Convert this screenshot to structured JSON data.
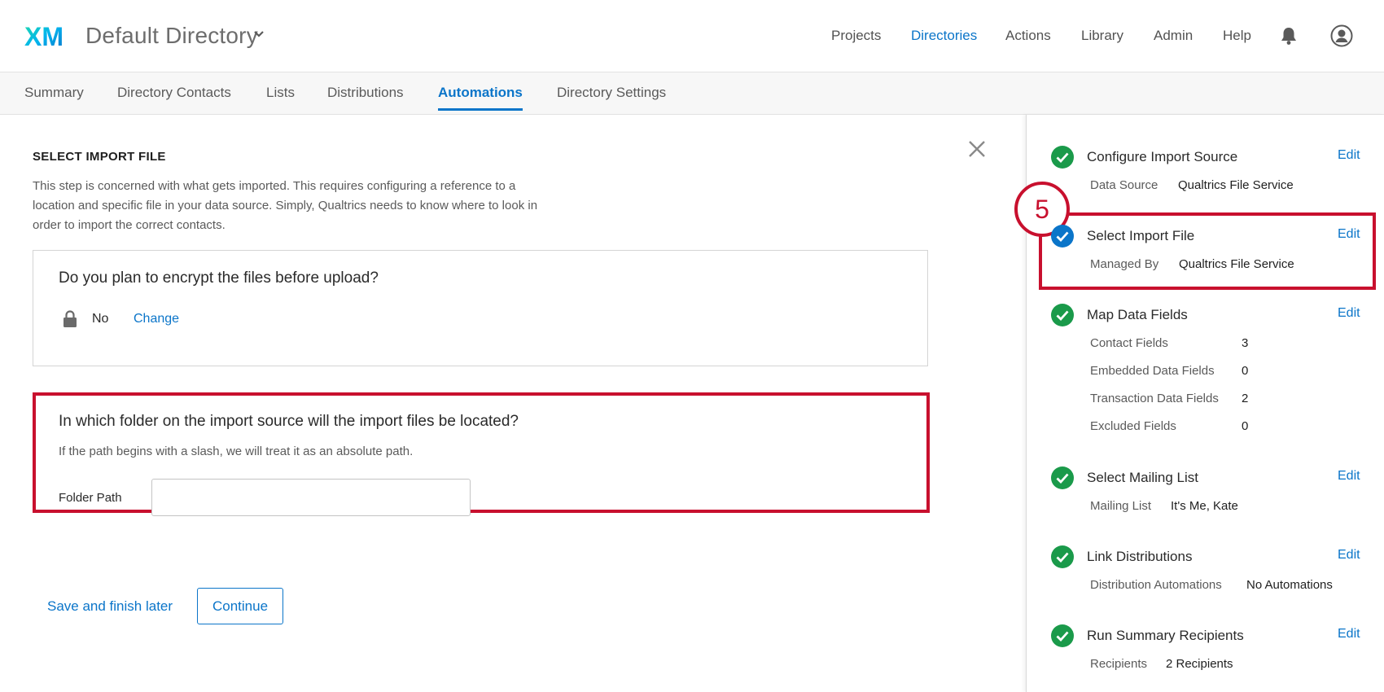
{
  "header": {
    "logo_text": "XM",
    "directory_title": "Default Directory",
    "nav": [
      {
        "label": "Projects",
        "active": false
      },
      {
        "label": "Directories",
        "active": true
      },
      {
        "label": "Actions",
        "active": false
      },
      {
        "label": "Library",
        "active": false
      },
      {
        "label": "Admin",
        "active": false
      },
      {
        "label": "Help",
        "active": false
      }
    ],
    "icons": [
      "bell-icon",
      "user-icon"
    ]
  },
  "tabs": [
    {
      "label": "Summary",
      "active": false
    },
    {
      "label": "Directory Contacts",
      "active": false
    },
    {
      "label": "Lists",
      "active": false
    },
    {
      "label": "Distributions",
      "active": false
    },
    {
      "label": "Automations",
      "active": true
    },
    {
      "label": "Directory Settings",
      "active": false
    }
  ],
  "main": {
    "section_title": "SELECT IMPORT FILE",
    "section_desc": "This step is concerned with what gets imported. This requires configuring a reference to a location and specific file in your data source. Simply, Qualtrics needs to know where to look in order to import the correct contacts.",
    "encrypt_card": {
      "question": "Do you plan to encrypt the files before upload?",
      "answer": "No",
      "change_label": "Change"
    },
    "folder_card": {
      "question": "In which folder on the import source will the import files be located?",
      "hint": "If the path begins with a slash, we will treat it as an absolute path.",
      "field_label": "Folder Path",
      "field_value": "",
      "field_placeholder": ""
    },
    "save_later_label": "Save and finish later",
    "continue_label": "Continue"
  },
  "sidebar": {
    "annotation_number": "5",
    "steps": [
      {
        "name": "Configure Import Source",
        "edit": "Edit",
        "status": "complete",
        "details": [
          {
            "k": "Data Source",
            "v": "Qualtrics File Service"
          }
        ]
      },
      {
        "name": "Select Import File",
        "edit": "Edit",
        "status": "current",
        "details": [
          {
            "k": "Managed By",
            "v": "Qualtrics File Service"
          }
        ]
      },
      {
        "name": "Map Data Fields",
        "edit": "Edit",
        "status": "complete",
        "details": [
          {
            "k": "Contact Fields",
            "v": "3"
          },
          {
            "k": "Embedded Data Fields",
            "v": "0"
          },
          {
            "k": "Transaction Data Fields",
            "v": "2"
          },
          {
            "k": "Excluded Fields",
            "v": "0"
          }
        ]
      },
      {
        "name": "Select Mailing List",
        "edit": "Edit",
        "status": "complete",
        "details": [
          {
            "k": "Mailing List",
            "v": "It's Me, Kate"
          }
        ]
      },
      {
        "name": "Link Distributions",
        "edit": "Edit",
        "status": "complete",
        "details": [
          {
            "k": "Distribution Automations",
            "v": "No Automations"
          }
        ]
      },
      {
        "name": "Run Summary Recipients",
        "edit": "Edit",
        "status": "complete",
        "details": [
          {
            "k": "Recipients",
            "v": "2 Recipients"
          }
        ]
      }
    ]
  },
  "colors": {
    "accent": "#0b75c9",
    "complete": "#1a9a4a",
    "current": "#0b75c9",
    "highlight": "#c8102e"
  }
}
